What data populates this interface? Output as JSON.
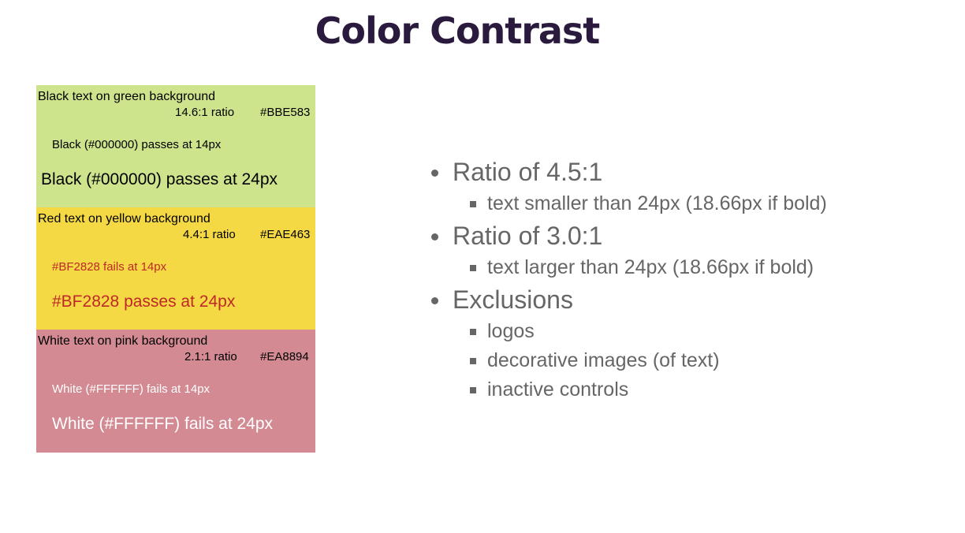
{
  "title": "Color Contrast",
  "swatches": [
    {
      "heading": "Black text on green background",
      "ratio": "14.6:1 ratio",
      "hex": "#BBE583",
      "small_text": "Black (#000000) passes at 14px",
      "large_text": "Black (#000000) passes at 24px",
      "background": "#cde38c",
      "text_color": "#000000",
      "heading_color": "#000000"
    },
    {
      "heading": "Red text on yellow background",
      "ratio": "4.4:1 ratio",
      "hex": "#EAE463",
      "small_text": "#BF2828 fails at 14px",
      "large_text": "#BF2828 passes at 24px",
      "background": "#f4d945",
      "text_color": "#bf2828",
      "heading_color": "#000000"
    },
    {
      "heading": "White text on pink background",
      "ratio": "2.1:1 ratio",
      "hex": "#EA8894",
      "small_text": "White (#FFFFFF) fails at 14px",
      "large_text": "White (#FFFFFF) fails at 24px",
      "background": "#d38a93",
      "text_color": "#ffffff",
      "heading_color": "#000000"
    }
  ],
  "bullets": [
    {
      "text": "Ratio of 4.5:1",
      "sub": [
        "text smaller than 24px (18.66px if bold)"
      ]
    },
    {
      "text": "Ratio of 3.0:1",
      "sub": [
        "text larger than 24px (18.66px if bold)"
      ]
    },
    {
      "text": "Exclusions",
      "sub": [
        "logos",
        "decorative images (of text)",
        "inactive controls"
      ]
    }
  ],
  "colors": {
    "title": "#2a1a3e",
    "bullet_text": "#666666"
  }
}
